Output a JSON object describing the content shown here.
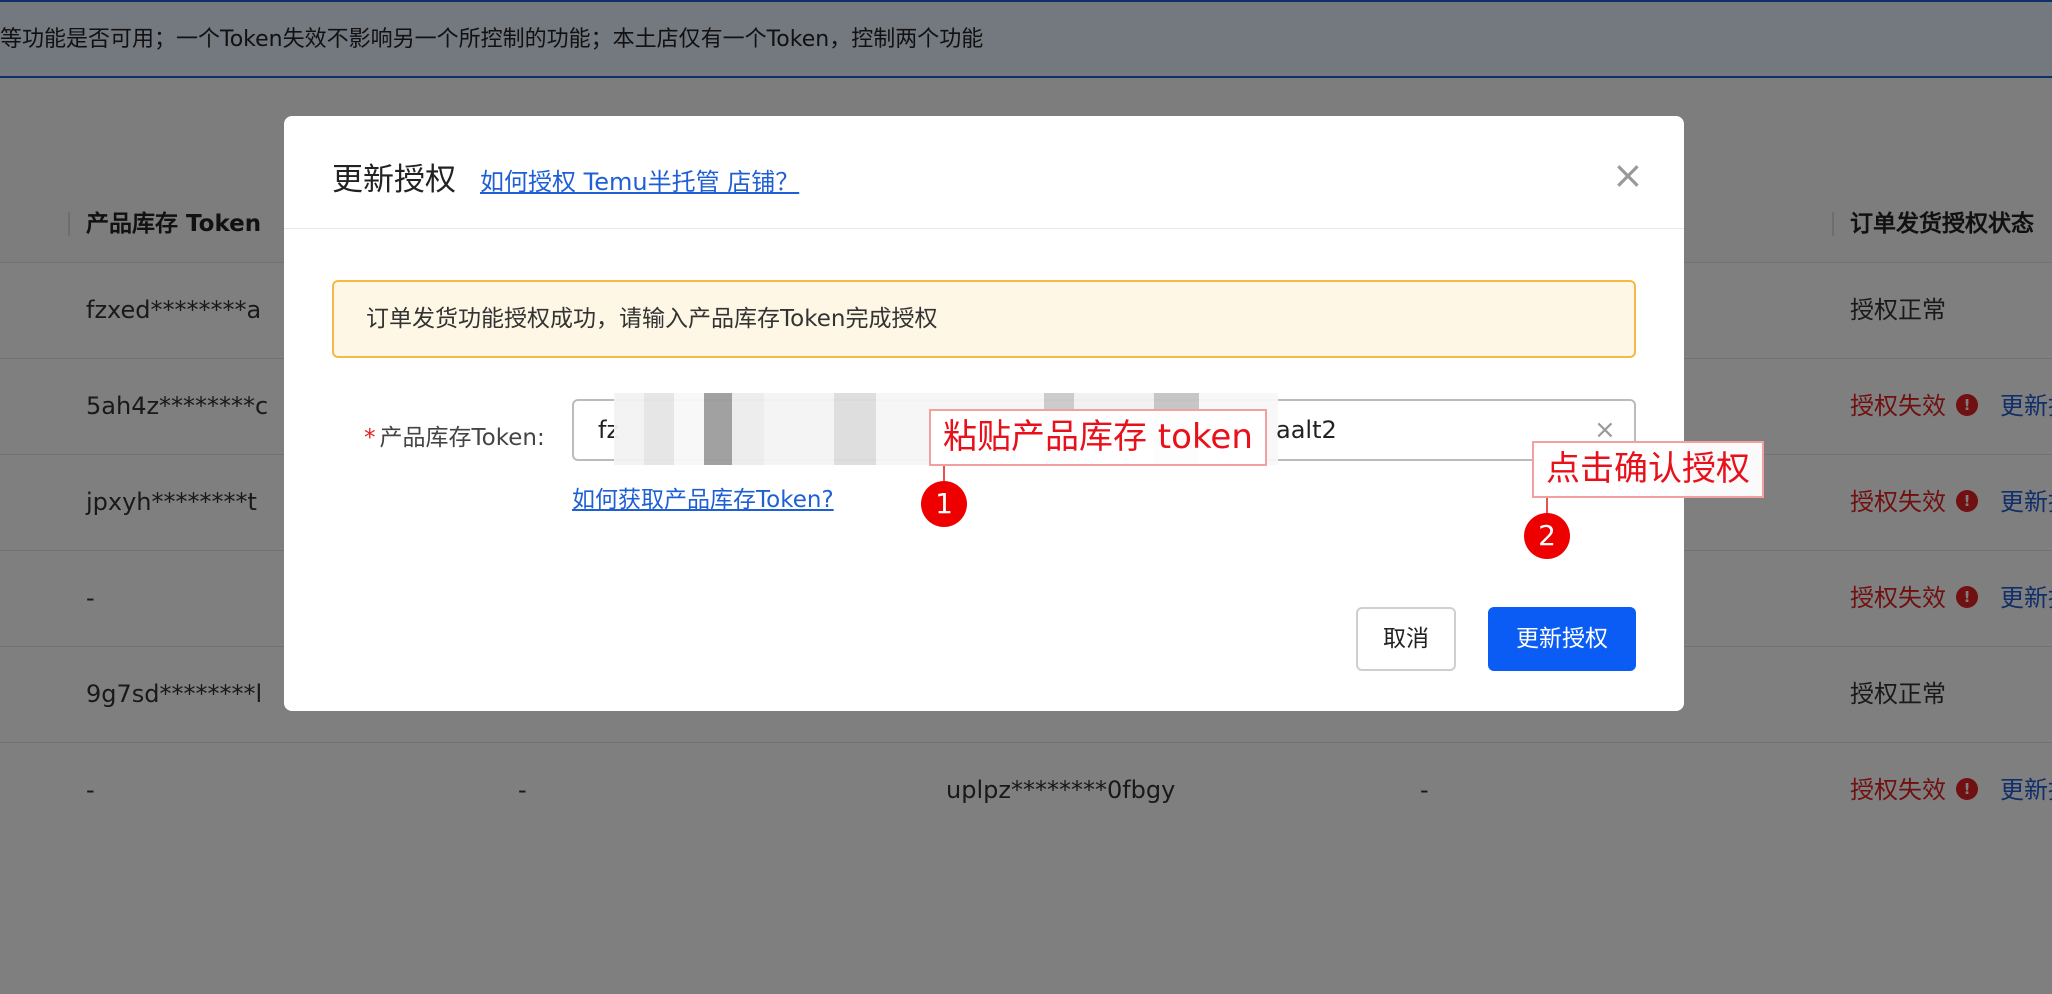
{
  "notice": "等功能是否可用；一个Token失效不影响另一个所控制的功能；本土店仅有一个Token，控制两个功能",
  "table": {
    "headers": {
      "inventory_token": "产品库存 Token",
      "order_status": "订单发货授权状态"
    },
    "rows": [
      {
        "inventory_token": "fzxed********a",
        "col2": "",
        "col3": "",
        "col4": "",
        "status": "授权正常",
        "status_type": "ok",
        "action": ""
      },
      {
        "inventory_token": "5ah4z********c",
        "col2": "",
        "col3": "",
        "col4": "",
        "status": "授权失效",
        "status_type": "bad",
        "action": "更新授"
      },
      {
        "inventory_token": "jpxyh********t",
        "col2": "",
        "col3": "",
        "col4": "",
        "status": "授权失效",
        "status_type": "bad",
        "action": "更新授"
      },
      {
        "inventory_token": "-",
        "col2": "",
        "col3": "",
        "col4": "",
        "status": "授权失效",
        "status_type": "bad",
        "action": "更新授"
      },
      {
        "inventory_token": "9g7sd********l",
        "col2": "",
        "col3": "",
        "col4": "",
        "status": "授权正常",
        "status_type": "ok",
        "action": ""
      },
      {
        "inventory_token": "-",
        "col2": "-",
        "col3": "uplpz********0fbgy",
        "col4": "-",
        "status": "授权失效",
        "status_type": "bad",
        "action": "更新授"
      }
    ],
    "warn_icon": "!"
  },
  "modal": {
    "title": "更新授权",
    "help_link": "如何授权 Temu半托管 店铺？",
    "close_icon": "×",
    "alert": "订单发货功能授权成功，请输入产品库存Token完成授权",
    "field_label": "产品库存Token:",
    "required_mark": "*",
    "token_value_start": "fz",
    "token_value_end": "aalt2",
    "clear_icon": "×",
    "token_help_link": "如何获取产品库存Token?",
    "cancel_button": "取消",
    "confirm_button": "更新授权"
  },
  "annotations": {
    "step1_label": "粘贴产品库存 token",
    "step1_number": "1",
    "step2_label": "点击确认授权",
    "step2_number": "2",
    "color": "#e8101a"
  }
}
